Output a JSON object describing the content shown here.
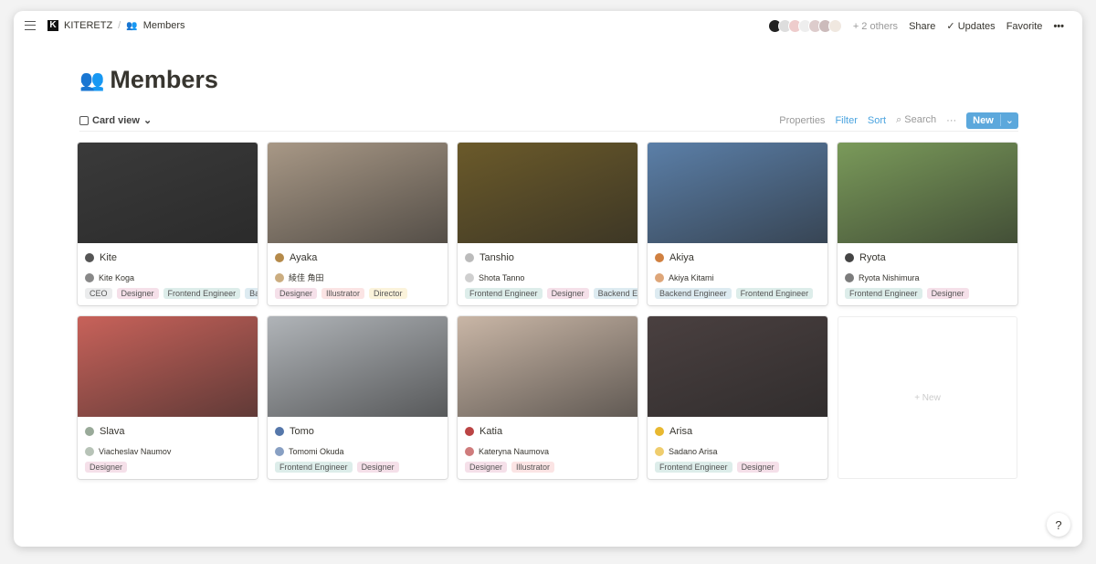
{
  "breadcrumb": {
    "workspace": "KITERETZ",
    "page": "Members"
  },
  "topbar": {
    "others": "+ 2 others",
    "share": "Share",
    "updates": "Updates",
    "favorite": "Favorite",
    "more": "•••"
  },
  "page": {
    "title": "Members",
    "icon": "busts-icon"
  },
  "toolbar": {
    "view": "Card view",
    "properties": "Properties",
    "filter": "Filter",
    "sort": "Sort",
    "search": "Search",
    "more": "···",
    "new": "New"
  },
  "tag_colors": {
    "CEO": "#ebeced",
    "Designer": "#f5e0e9",
    "Frontend Engineer": "#ddedea",
    "Backend Engineer": "#ddebf1",
    "Illustrator": "#fbe4e4",
    "Director": "#fbf3db"
  },
  "cards": [
    {
      "name": "Kite",
      "person": "Kite Koga",
      "tags": [
        "CEO",
        "Designer",
        "Frontend Engineer",
        "Backend Engineer"
      ],
      "img": "#3a3a3a",
      "icon": "#555"
    },
    {
      "name": "Ayaka",
      "person": "綾佳 角田",
      "tags": [
        "Designer",
        "Illustrator",
        "Director"
      ],
      "img": "#a89886",
      "icon": "#b58a4a"
    },
    {
      "name": "Tanshio",
      "person": "Shota Tanno",
      "tags": [
        "Frontend Engineer",
        "Designer",
        "Backend Engineer"
      ],
      "img": "#6b5a2a",
      "icon": "#bbb"
    },
    {
      "name": "Akiya",
      "person": "Akiya Kitami",
      "tags": [
        "Backend Engineer",
        "Frontend Engineer"
      ],
      "img": "#5b7fa8",
      "icon": "#d08040"
    },
    {
      "name": "Ryota",
      "person": "Ryota Nishimura",
      "tags": [
        "Frontend Engineer",
        "Designer"
      ],
      "img": "#7a9a5a",
      "icon": "#444"
    },
    {
      "name": "Slava",
      "person": "Viacheslav Naumov",
      "tags": [
        "Designer"
      ],
      "img": "#c8625a",
      "icon": "#9a9"
    },
    {
      "name": "Tomo",
      "person": "Tomomi Okuda",
      "tags": [
        "Frontend Engineer",
        "Designer"
      ],
      "img": "#b0b4b8",
      "icon": "#57a"
    },
    {
      "name": "Katia",
      "person": "Kateryna Naumova",
      "tags": [
        "Designer",
        "Illustrator"
      ],
      "img": "#c9b6a6",
      "icon": "#b44"
    },
    {
      "name": "Arisa",
      "person": "Sadano Arisa",
      "tags": [
        "Frontend Engineer",
        "Designer"
      ],
      "img": "#4a4040",
      "icon": "#e8b830"
    }
  ],
  "new_card": "+ New",
  "help": "?"
}
